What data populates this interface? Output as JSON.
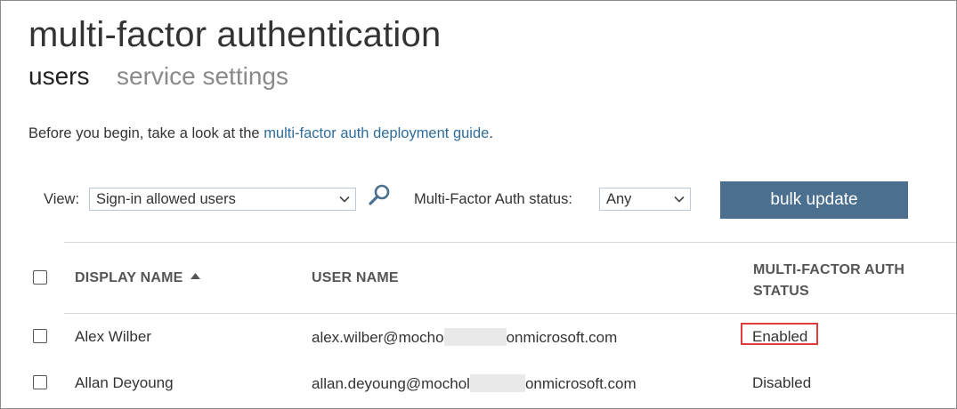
{
  "header": {
    "title": "multi-factor authentication",
    "tabs": [
      {
        "label": "users",
        "active": true
      },
      {
        "label": "service settings",
        "active": false
      }
    ]
  },
  "intro": {
    "text_before": "Before you begin, take a look at the ",
    "link_text": "multi-factor auth deployment guide",
    "text_after": "."
  },
  "filters": {
    "view_label": "View:",
    "view_value": "Sign-in allowed users",
    "status_label": "Multi-Factor Auth status:",
    "status_value": "Any"
  },
  "actions": {
    "bulk_update_label": "bulk update"
  },
  "table": {
    "columns": {
      "display_name": "DISPLAY NAME",
      "user_name": "USER NAME",
      "mfa_status_line1": "MULTI-FACTOR AUTH",
      "mfa_status_line2": "STATUS"
    },
    "sort": {
      "column": "display_name",
      "direction": "ascending"
    },
    "rows": [
      {
        "display_name": "Alex Wilber",
        "user_prefix": "alex.wilber@mocho",
        "user_suffix": "onmicrosoft.com",
        "status": "Enabled",
        "highlighted": true
      },
      {
        "display_name": "Allan Deyoung",
        "user_prefix": "allan.deyoung@mochol",
        "user_suffix": "onmicrosoft.com",
        "status": "Disabled",
        "highlighted": false
      }
    ]
  },
  "colors": {
    "accent_button": "#4b6f8f",
    "link": "#2f6d9b",
    "highlight_border": "#e03c3c"
  }
}
